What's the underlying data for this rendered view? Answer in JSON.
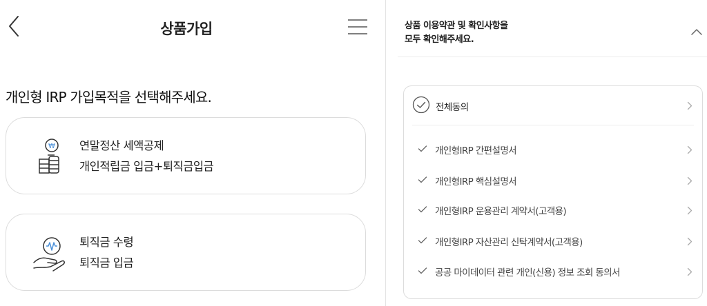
{
  "header": {
    "title": "상품가입",
    "back_icon": "chevron-left-icon",
    "menu_icon": "hamburger-menu-icon"
  },
  "main": {
    "heading": "개인형 IRP 가입목적을 선택해주세요.",
    "options": [
      {
        "icon": "coin-stack-icon",
        "line1": "연말정산 세액공제",
        "line2": "개인적립금 입금+퇴직금입금"
      },
      {
        "icon": "hand-coin-icon",
        "line1": "퇴직금 수령",
        "line2": "퇴직금 입금"
      }
    ]
  },
  "terms": {
    "title_line1": "상품 이용약관 및 확인사항을",
    "title_line2": "모두 확인해주세요.",
    "collapse_icon": "chevron-up-icon",
    "agree_all": "전체동의",
    "items": [
      "개인형IRP 간편설명서",
      "개인형IRP 핵심설명서",
      "개인형IRP 운용관리 계약서(고객용)",
      "개인형IRP 자산관리 신탁계약서(고객용)",
      "공공 마이데이터 관련 개인(신용) 정보 조회 동의서"
    ]
  },
  "colors": {
    "icon_accent": "#4a90d9",
    "border": "#dcdcdc",
    "text": "#222222"
  }
}
